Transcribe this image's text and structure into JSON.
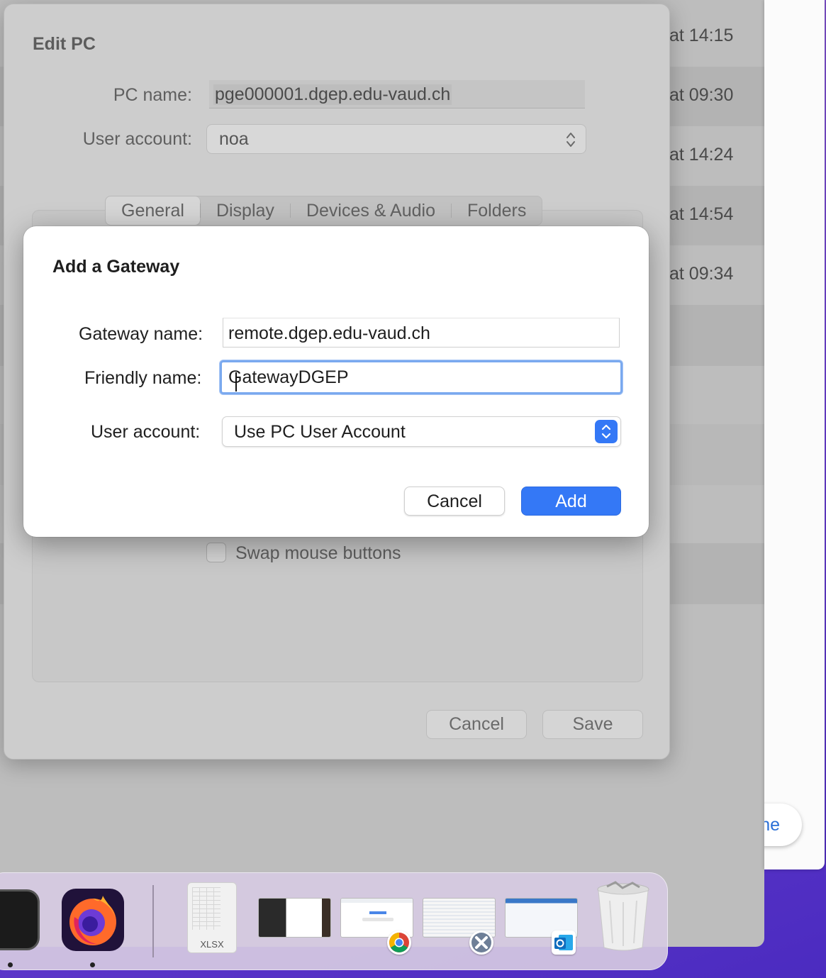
{
  "background_list": {
    "timestamps": [
      "at 14:15",
      "at 09:30",
      "at 14:24",
      "at 14:54",
      "at 09:34"
    ]
  },
  "right_panel": {
    "button_label_partial": "ne"
  },
  "edit_pc": {
    "title": "Edit PC",
    "pc_name_label": "PC name:",
    "pc_name_value": "pge000001.dgep.edu-vaud.ch",
    "user_account_label": "User account:",
    "user_account_value": "noa",
    "tabs": [
      {
        "label": "General",
        "selected": true
      },
      {
        "label": "Display",
        "selected": false
      },
      {
        "label": "Devices & Audio",
        "selected": false
      },
      {
        "label": "Folders",
        "selected": false
      }
    ],
    "swap_mouse_label": "Swap mouse buttons",
    "swap_mouse_checked": false,
    "cancel_label": "Cancel",
    "save_label": "Save"
  },
  "modal": {
    "title": "Add a Gateway",
    "gateway_name_label": "Gateway name:",
    "gateway_name_value": "remote.dgep.edu-vaud.ch",
    "friendly_name_label": "Friendly name:",
    "friendly_name_value": "GatewayDGEP",
    "user_account_label": "User account:",
    "user_account_value": "Use PC User Account",
    "cancel_label": "Cancel",
    "add_label": "Add"
  },
  "dock": {
    "xlsx_label": "XLSX",
    "items": [
      "terminal-icon",
      "firefox-icon",
      "xlsx-file-icon",
      "window-thumbnail",
      "chrome-window-thumbnail",
      "adm-window-thumbnail",
      "outlook-window-thumbnail",
      "trash-icon"
    ]
  },
  "colors": {
    "accent": "#3478f6",
    "focus_ring": "#7aa9ef",
    "desktop": "#6a3fd0"
  }
}
